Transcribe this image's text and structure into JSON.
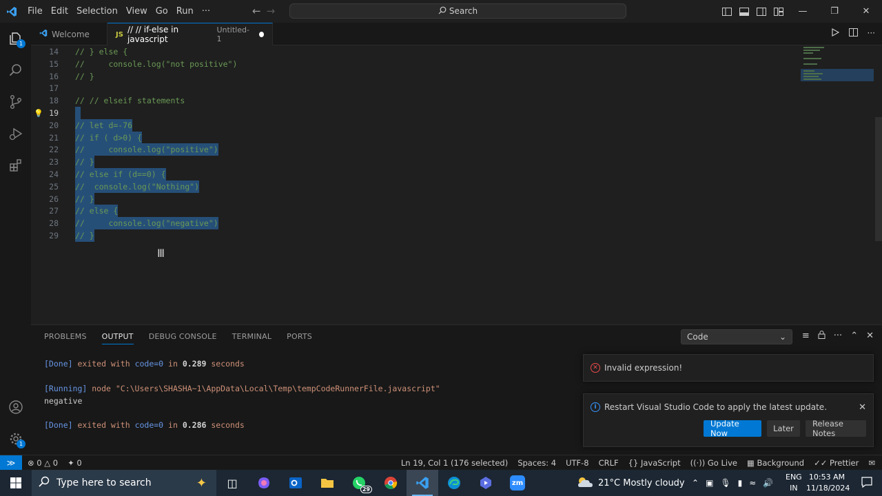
{
  "menu": [
    "File",
    "Edit",
    "Selection",
    "View",
    "Go",
    "Run",
    "···"
  ],
  "search": {
    "label": "Search"
  },
  "activity": {
    "explorer_badge": "1",
    "settings_badge": "1"
  },
  "tabs": [
    {
      "label": "Welcome"
    },
    {
      "icon": "JS",
      "label": "// // if-else in javascript",
      "sublabel": "Untitled-1"
    }
  ],
  "editor": {
    "lines": [
      {
        "n": "14",
        "text": "// } else {",
        "sel": false
      },
      {
        "n": "15",
        "text": "//     console.log(\"not positive\")",
        "sel": false
      },
      {
        "n": "16",
        "text": "// }",
        "sel": false
      },
      {
        "n": "17",
        "text": "",
        "sel": false
      },
      {
        "n": "18",
        "text": "// // elseif statements",
        "sel": false
      },
      {
        "n": "19",
        "text": "",
        "sel": true,
        "current": true
      },
      {
        "n": "20",
        "text": "// let d=-76",
        "sel": true
      },
      {
        "n": "21",
        "text": "// if ( d>0) {",
        "sel": true
      },
      {
        "n": "22",
        "text": "//     console.log(\"positive\")",
        "sel": true
      },
      {
        "n": "23",
        "text": "// }",
        "sel": true
      },
      {
        "n": "24",
        "text": "// else if (d==0) {",
        "sel": true
      },
      {
        "n": "25",
        "text": "//  console.log(\"Nothing\")",
        "sel": true
      },
      {
        "n": "26",
        "text": "// }",
        "sel": true
      },
      {
        "n": "27",
        "text": "// else {",
        "sel": true
      },
      {
        "n": "28",
        "text": "//     console.log(\"negative\")",
        "sel": true
      },
      {
        "n": "29",
        "text": "// }",
        "sel": true
      }
    ]
  },
  "panel": {
    "tabs": [
      "PROBLEMS",
      "OUTPUT",
      "DEBUG CONSOLE",
      "TERMINAL",
      "PORTS"
    ],
    "active_tab": "OUTPUT",
    "channel": "Code",
    "output": {
      "done1_tag": "[Done]",
      "done1_text": " exited with ",
      "done1_code": "code=0",
      "done1_in": " in ",
      "done1_time": "0.289",
      "done1_sec": " seconds",
      "running_tag": "[Running]",
      "running_cmd": " node ",
      "running_path": "\"C:\\Users\\SHASHA~1\\AppData\\Local\\Temp\\tempCodeRunnerFile.javascript\"",
      "result": "negative",
      "done2_tag": "[Done]",
      "done2_text": " exited with ",
      "done2_code": "code=0",
      "done2_in": " in ",
      "done2_time": "0.286",
      "done2_sec": " seconds"
    }
  },
  "notifications": {
    "error": "Invalid expression!",
    "update": "Restart Visual Studio Code to apply the latest update.",
    "update_now": "Update Now",
    "later": "Later",
    "release_notes": "Release Notes"
  },
  "statusbar": {
    "errors": "0",
    "warnings": "0",
    "ports": "0",
    "position": "Ln 19, Col 1 (176 selected)",
    "spaces": "Spaces: 4",
    "encoding": "UTF-8",
    "eol": "CRLF",
    "language": "JavaScript",
    "golive": "Go Live",
    "background": "Background",
    "prettier": "Prettier"
  },
  "taskbar": {
    "search_placeholder": "Type here to search",
    "whatsapp_badge": "29",
    "zoom_label": "zm",
    "weather": "21°C  Mostly cloudy",
    "lang1": "ENG",
    "lang2": "IN",
    "time": "10:53 AM",
    "date": "11/18/2024"
  },
  "colors": {
    "accent": "#0078d4",
    "selection": "#264f78",
    "comment": "#6a9955",
    "error": "#f14c4c"
  }
}
